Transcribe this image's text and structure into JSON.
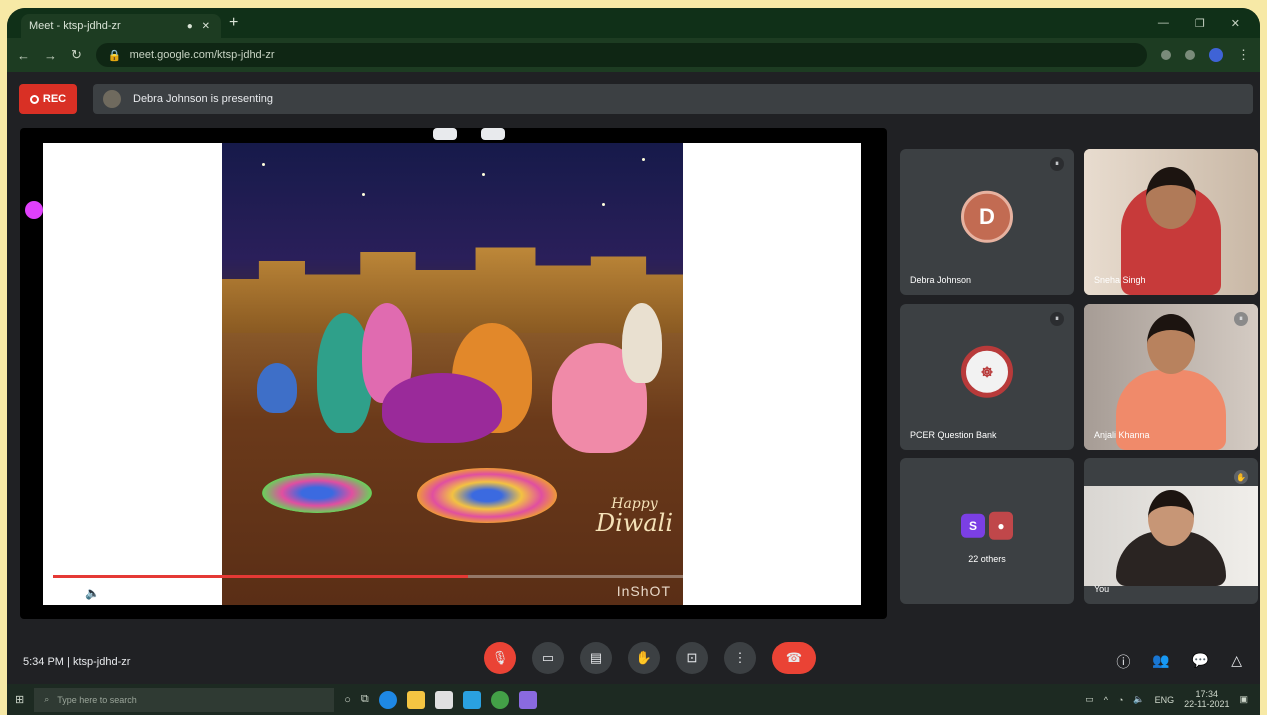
{
  "browser": {
    "tab_title": "Meet - ktsp-jdhd-zr",
    "url": "meet.google.com/ktsp-jdhd-zr",
    "new_tab_icon": "plus-icon"
  },
  "meet": {
    "rec_label": "REC",
    "presenting_text": "Debra Johnson is presenting",
    "presenter_initial": "D"
  },
  "presentation": {
    "greeting_line1": "Happy",
    "greeting_line2": "Diwali",
    "brand": "InShOT",
    "progress_fraction": 0.52,
    "time_text": "",
    "colors": {
      "progress": "#e53935"
    }
  },
  "participants": [
    {
      "name": "Debra Johnson",
      "initial": "D",
      "avatar_color": "#c26b52",
      "type": "avatar"
    },
    {
      "name": "Sneha Singh",
      "type": "camera"
    },
    {
      "name": "PCER Question Bank",
      "initial": "",
      "avatar_color": "#b83a3a",
      "type": "logo"
    },
    {
      "name": "Anjali Khanna",
      "type": "camera"
    },
    {
      "name": "22 others",
      "initial": "S",
      "avatar_color": "#7b3fe4",
      "type": "group"
    },
    {
      "name": "You",
      "type": "camera"
    }
  ],
  "bottom_bar": {
    "time": "5:34 PM",
    "meeting_code": "ktsp-jdhd-zr"
  },
  "taskbar": {
    "search_placeholder": "Type here to search",
    "clock_time": "17:34",
    "clock_date": "22-11-2021"
  }
}
